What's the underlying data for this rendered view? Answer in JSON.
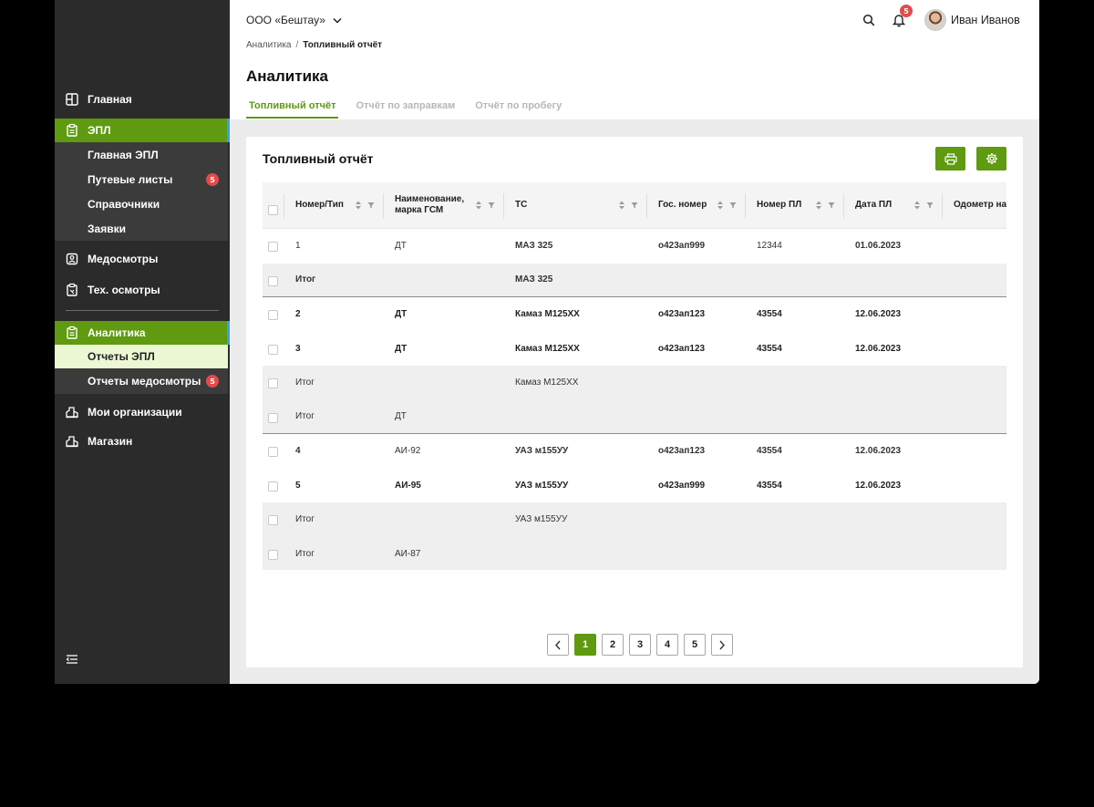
{
  "sidebar": {
    "items": [
      {
        "label": "Главная",
        "icon": "home-icon"
      },
      {
        "label": "ЭПЛ",
        "icon": "clipboard-icon"
      },
      {
        "label": "Медосмотры",
        "icon": "medical-check-icon"
      },
      {
        "label": "Тех. осмотры",
        "icon": "tech-inspection-icon"
      },
      {
        "label": "Аналитика",
        "icon": "analytics-clipboard-icon"
      },
      {
        "label": "Мои организации",
        "icon": "organizations-icon"
      },
      {
        "label": "Магазин",
        "icon": "shop-icon"
      }
    ],
    "epl_sub": [
      {
        "label": "Главная ЭПЛ"
      },
      {
        "label": "Путевые листы",
        "badge": "5"
      },
      {
        "label": "Справочники"
      },
      {
        "label": "Заявки"
      }
    ],
    "analytics_sub": [
      {
        "label": "Отчеты ЭПЛ"
      },
      {
        "label": "Отчеты медосмотры",
        "badge": "5"
      }
    ]
  },
  "header": {
    "org": "ООО «Бештау»",
    "notifications": "5",
    "user": "Иван Иванов"
  },
  "breadcrumb": {
    "parent": "Аналитика",
    "sep": "/",
    "current": "Топливный отчёт"
  },
  "page_title": "Аналитика",
  "tabs": [
    "Топливный отчёт",
    "Отчёт по заправкам",
    "Отчёт по пробегу"
  ],
  "card": {
    "title": "Топливный отчёт"
  },
  "table": {
    "columns": [
      "Номер/Тип",
      "Наименование, марка ГСМ",
      "ТС",
      "Гос. номер",
      "Номер ПЛ",
      "Дата ПЛ",
      "Одометр на"
    ],
    "rows": [
      [
        "1",
        "ДТ",
        "МАЗ 325",
        "о423ап999",
        "12344",
        "01.06.2023"
      ],
      [
        "Итог",
        "",
        "МАЗ 325",
        "",
        "",
        ""
      ],
      [
        "2",
        "ДТ",
        "Камаз М125ХХ",
        "о423ап123",
        "43554",
        "12.06.2023"
      ],
      [
        "3",
        "ДТ",
        "Камаз М125ХХ",
        "о423ап123",
        "43554",
        "12.06.2023"
      ],
      [
        "Итог",
        "",
        "Камаз М125ХХ",
        "",
        "",
        ""
      ],
      [
        "Итог",
        "ДТ",
        "",
        "",
        "",
        ""
      ],
      [
        "4",
        "АИ-92",
        "УАЗ м155УУ",
        "о423ап123",
        "43554",
        "12.06.2023"
      ],
      [
        "5",
        "АИ-95",
        "УАЗ м155УУ",
        "о423ап999",
        "43554",
        "12.06.2023"
      ],
      [
        "Итог",
        "",
        "УАЗ м155УУ",
        "",
        "",
        ""
      ],
      [
        "Итог",
        "АИ-87",
        "",
        "",
        "",
        ""
      ]
    ]
  },
  "pagination": {
    "pages": [
      "1",
      "2",
      "3",
      "4",
      "5"
    ],
    "current": "1"
  }
}
